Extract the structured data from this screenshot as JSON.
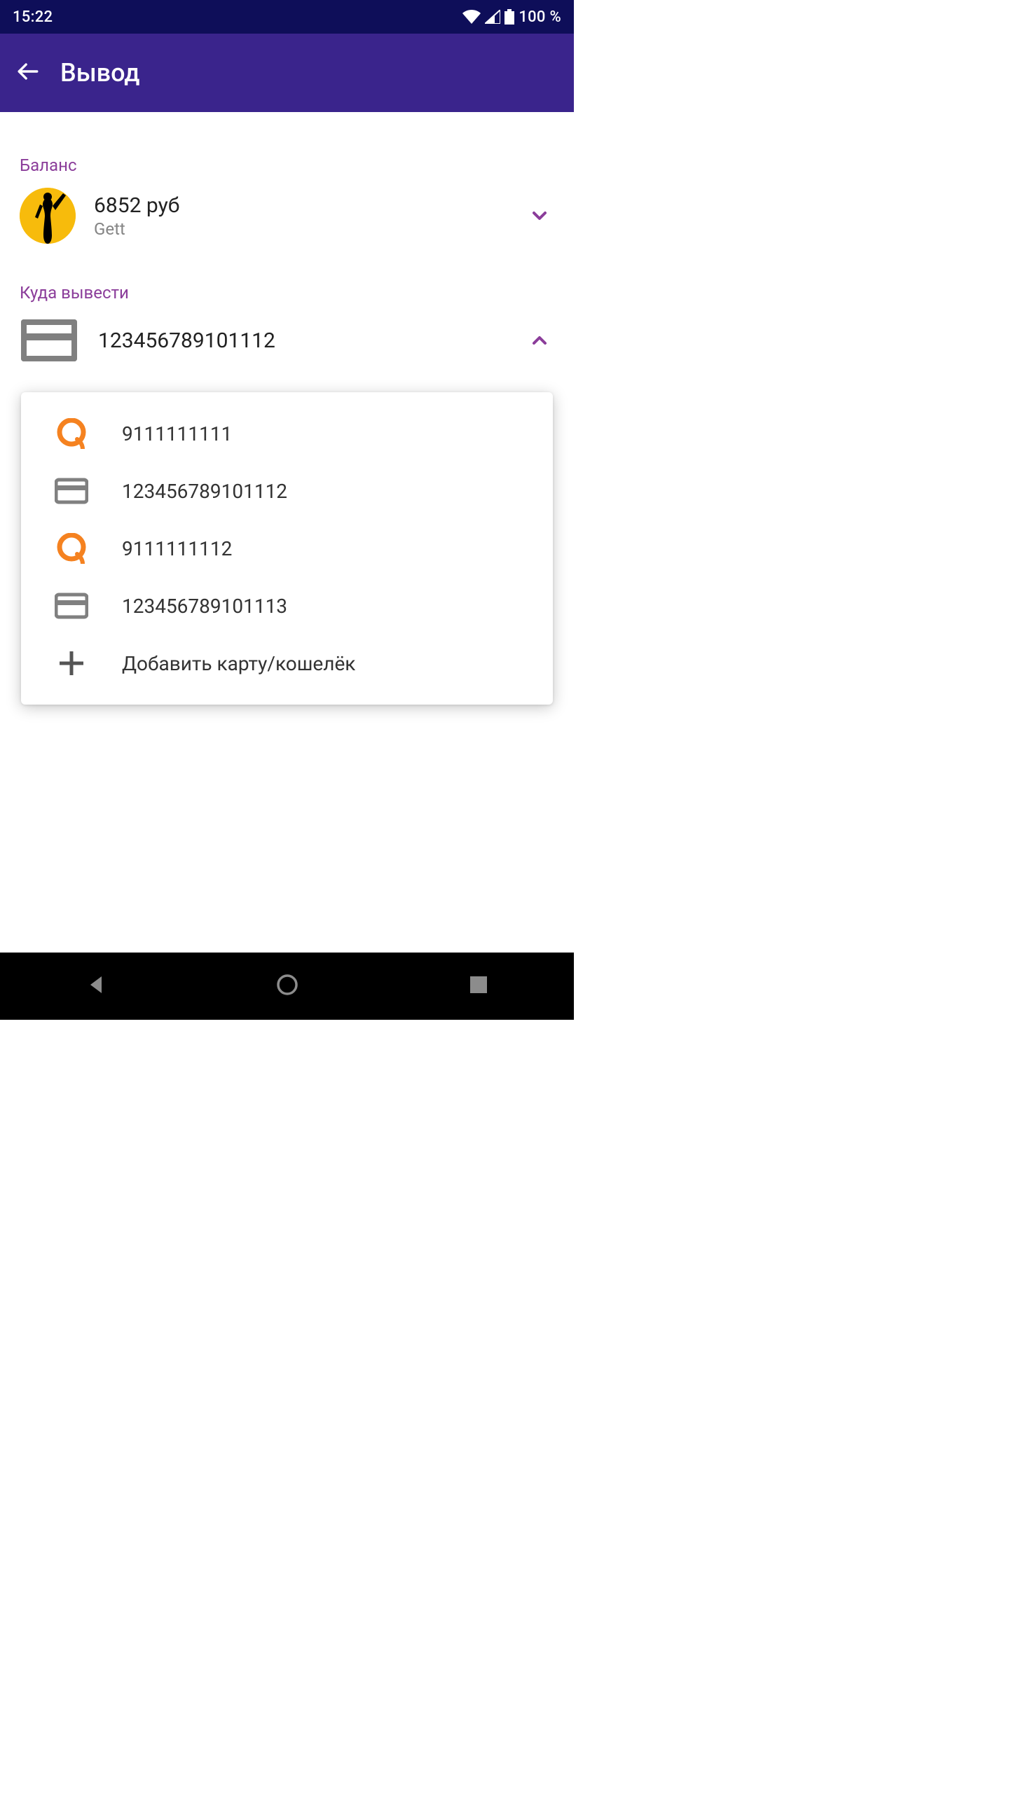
{
  "status": {
    "time": "15:22",
    "battery": "100 %"
  },
  "header": {
    "title": "Вывод"
  },
  "balance": {
    "label": "Баланс",
    "amount": "6852 руб",
    "provider": "Gett"
  },
  "destination": {
    "label": "Куда вывести",
    "selected": "123456789101112"
  },
  "options": [
    {
      "icon": "qiwi",
      "text": "9111111111"
    },
    {
      "icon": "card",
      "text": "123456789101112"
    },
    {
      "icon": "qiwi",
      "text": "9111111112"
    },
    {
      "icon": "card",
      "text": "123456789101113"
    },
    {
      "icon": "plus",
      "text": "Добавить карту/кошелёк"
    }
  ]
}
